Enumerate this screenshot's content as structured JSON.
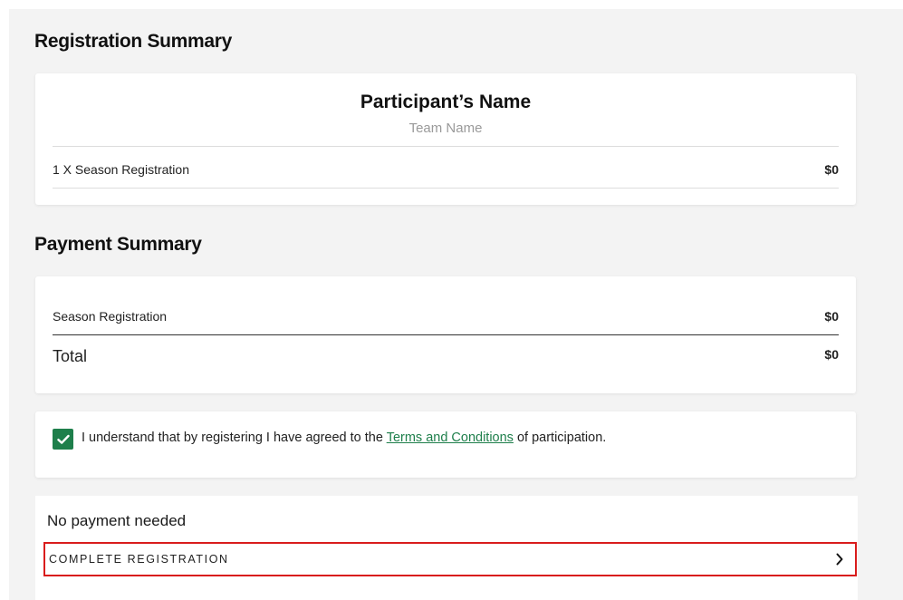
{
  "registration_summary": {
    "title": "Registration Summary",
    "participant_name": "Participant’s Name",
    "team_name": "Team Name",
    "line_items": [
      {
        "label": "1 X Season Registration",
        "price": "$0"
      }
    ]
  },
  "payment_summary": {
    "title": "Payment Summary",
    "items": [
      {
        "label": "Season Registration",
        "price": "$0"
      }
    ],
    "total_label": "Total",
    "total_price": "$0"
  },
  "agreement": {
    "checked": true,
    "text_before": "I understand that by registering I have agreed to the ",
    "link_text": "Terms and Conditions",
    "text_after": " of participation."
  },
  "payment": {
    "status_text": "No payment needed",
    "complete_button_label": "COMPLETE REGISTRATION"
  },
  "colors": {
    "accent_green": "#1e7f4b",
    "highlight_red": "#d91c1c",
    "background": "#f3f3f3"
  },
  "icons": {
    "checkbox": "check-icon",
    "button_arrow": "chevron-right-icon"
  }
}
